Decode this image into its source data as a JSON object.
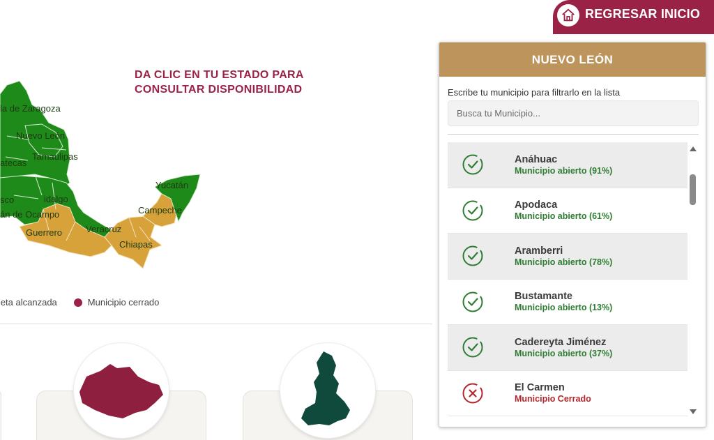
{
  "header": {
    "return_button_label": "REGRESAR INICIO",
    "return_icon": "home-icon",
    "accent_color": "#9b2247"
  },
  "map": {
    "title_line1": "DA CLIC EN TU ESTADO PARA",
    "title_line2": "CONSULTAR DISPONIBILIDAD",
    "state_labels": {
      "coahuila": "la de Zaragoza",
      "nuevo_leon": "Nuevo León",
      "tamaulipas": "Tamaulipas",
      "zacatecas": "atecas",
      "yucatan": "Yucatán",
      "campeche": "Campeche",
      "hidalgo": "idalgo",
      "veracruz": "Veracruz",
      "michoacan": "án de Ocampo",
      "jalisco": "sco",
      "guerrero": "Guerrero",
      "chiapas": "Chiapas"
    },
    "colors": {
      "open": "#1e8a1a",
      "goal_reached": "#d8a23a",
      "closed": "#9b2247"
    },
    "legend": {
      "goal_label": "Meta alcanzada",
      "closed_label": "Municipio cerrado"
    }
  },
  "panel": {
    "title": "NUEVO LEÓN",
    "header_color": "#bd955c",
    "filter_label": "Escribe tu municipio para filtrarlo en la lista",
    "search_placeholder": "Busca tu Municipio...",
    "search_value": "",
    "municipalities": [
      {
        "name": "Anáhuac",
        "status": "Municipio abierto (91%)",
        "state": "open",
        "icon": "check-circle-icon"
      },
      {
        "name": "Apodaca",
        "status": "Municipio abierto (61%)",
        "state": "open",
        "icon": "check-circle-icon"
      },
      {
        "name": "Aramberri",
        "status": "Municipio abierto (78%)",
        "state": "open",
        "icon": "check-circle-icon"
      },
      {
        "name": "Bustamante",
        "status": "Municipio abierto (13%)",
        "state": "open",
        "icon": "check-circle-icon"
      },
      {
        "name": "Cadereyta Jiménez",
        "status": "Municipio abierto (37%)",
        "state": "open",
        "icon": "check-circle-icon"
      },
      {
        "name": "El Carmen",
        "status": "Municipio Cerrado",
        "state": "closed",
        "icon": "x-circle-icon"
      }
    ],
    "status_colors": {
      "open": "#2e7d32",
      "closed": "#b3262b"
    }
  },
  "cards": [
    {
      "state_shape": "oaxaca-shape-icon",
      "color": "#8e1f3f"
    },
    {
      "state_shape": "puebla-shape-icon",
      "color": "#0f4a3c"
    }
  ]
}
